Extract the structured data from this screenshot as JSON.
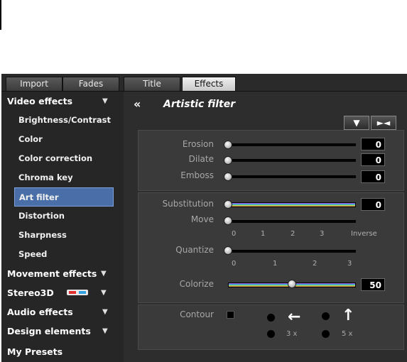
{
  "tabs": [
    "Import",
    "Fades",
    "Title",
    "Effects"
  ],
  "active_tab": "Effects",
  "sidebar": {
    "items": [
      {
        "label": "Video effects",
        "type": "category",
        "expanded": true
      },
      {
        "label": "Brightness/Contrast",
        "type": "item"
      },
      {
        "label": "Color",
        "type": "item"
      },
      {
        "label": "Color correction",
        "type": "item"
      },
      {
        "label": "Chroma key",
        "type": "item"
      },
      {
        "label": "Art filter",
        "type": "item",
        "selected": true
      },
      {
        "label": "Distortion",
        "type": "item"
      },
      {
        "label": "Sharpness",
        "type": "item"
      },
      {
        "label": "Speed",
        "type": "item"
      },
      {
        "label": "Movement effects",
        "type": "category"
      },
      {
        "label": "Stereo3D",
        "type": "category"
      },
      {
        "label": "Audio effects",
        "type": "category"
      },
      {
        "label": "Design elements",
        "type": "category"
      },
      {
        "label": "My Presets",
        "type": "category"
      }
    ]
  },
  "panel": {
    "back_icon": "double-chevron-left-icon",
    "title": "Artistic filter",
    "toolbar": {
      "dropdown_glyph": "▼",
      "play_glyph": "►◄"
    },
    "group1": [
      {
        "label": "Erosion",
        "value": "0",
        "level": 0
      },
      {
        "label": "Dilate",
        "value": "0",
        "level": 0
      },
      {
        "label": "Emboss",
        "value": "0",
        "level": 0
      }
    ],
    "substitution": {
      "label": "Substitution",
      "value": "0",
      "level": 0
    },
    "move": {
      "label": "Move",
      "ticks": [
        "0",
        "1",
        "2",
        "3",
        "Inverse"
      ],
      "level": 0
    },
    "quantize": {
      "label": "Quantize",
      "ticks": [
        "0",
        "1",
        "2",
        "3"
      ],
      "level": 0
    },
    "colorize": {
      "label": "Colorize",
      "value": "50",
      "level": 0.5
    },
    "contour": {
      "label": "Contour",
      "mult1": "3 x",
      "mult2": "5 x"
    }
  }
}
